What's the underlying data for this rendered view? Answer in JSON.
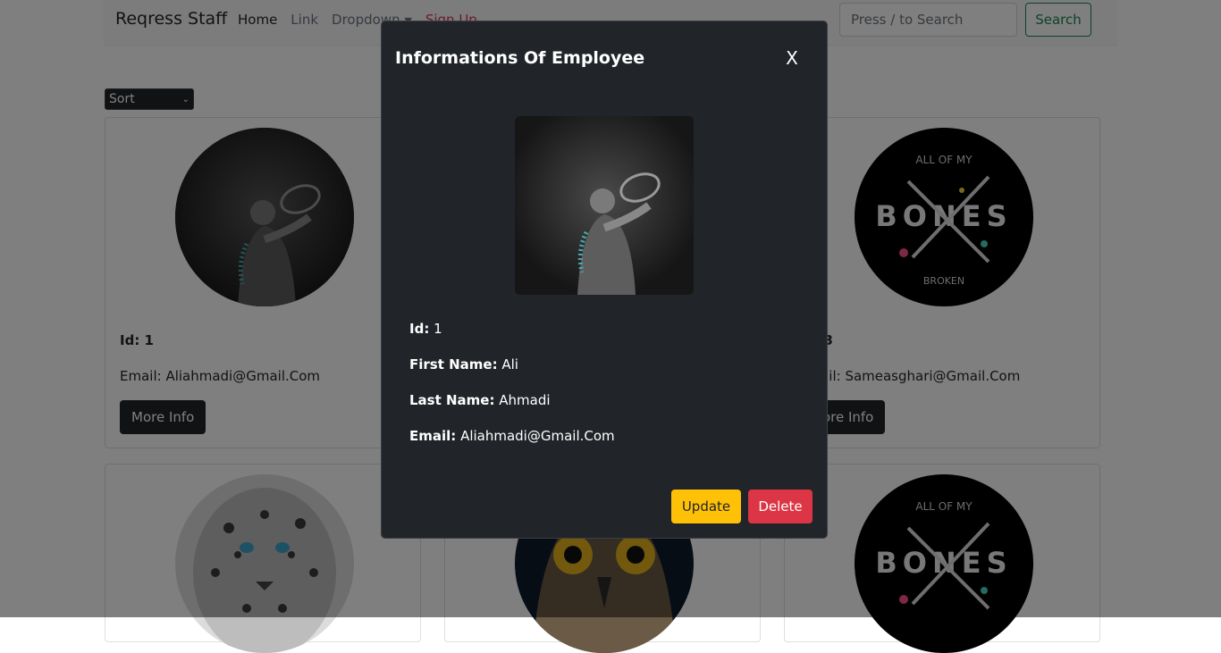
{
  "navbar": {
    "brand": "Reqress Staff",
    "links": {
      "home": "Home",
      "link": "Link",
      "dropdown": "Dropdown",
      "signup": "Sign Up"
    },
    "search": {
      "placeholder": "Press / to Search",
      "button": "Search"
    }
  },
  "sort": {
    "selected": "Sort"
  },
  "cards": [
    {
      "id_label": "Id: 1",
      "email": "Email: Aliahmadi@Gmail.Com",
      "button": "More Info",
      "image": "tennis-player"
    },
    {
      "id_label": "Id: 3",
      "email": "Email: Sameasghari@Gmail.Com",
      "button": "More Info",
      "image": "all-of-my-bones-art"
    },
    {
      "image": "snow-leopard"
    },
    {
      "image": "owl"
    },
    {
      "image": "all-of-my-bones-art"
    }
  ],
  "bones_art": {
    "top": "ALL OF MY",
    "middle": "BONES",
    "bottom": "BROKEN"
  },
  "modal": {
    "title": "Informations Of Employee",
    "close": "X",
    "fields": [
      {
        "label": "Id:",
        "value": "1"
      },
      {
        "label": "First Name:",
        "value": "Ali"
      },
      {
        "label": "Last Name:",
        "value": "Ahmadi"
      },
      {
        "label": "Email:",
        "value": "Aliahmadi@Gmail.Com"
      }
    ],
    "update_button": "Update",
    "delete_button": "Delete"
  },
  "colors": {
    "dark": "#212529",
    "warning": "#ffc107",
    "danger": "#dc3545",
    "success": "#198754"
  }
}
